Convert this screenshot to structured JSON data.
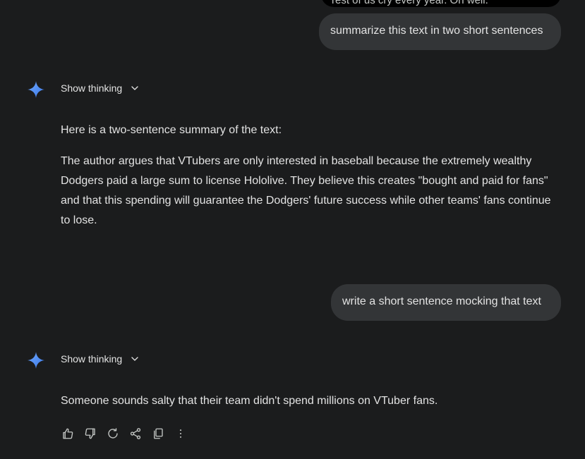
{
  "chat": {
    "prev_user_bubble_tail": "rest of us cry every year. Oh well.",
    "turn1": {
      "user_message": "summarize this text in two short sentences",
      "thinking_label": "Show thinking",
      "response_intro": "Here is a two-sentence summary of the text:",
      "response_body": "The author argues that VTubers are only interested in baseball because the extremely wealthy Dodgers paid a large sum to license Hololive. They believe this creates \"bought and paid for fans\" and that this spending will guarantee the Dodgers' future success while other teams' fans continue to lose."
    },
    "turn2": {
      "user_message": "write a short sentence mocking that text",
      "thinking_label": "Show thinking",
      "response_body": "Someone sounds salty that their team didn't spend millions on VTuber fans."
    }
  },
  "icons": {
    "assistant_avatar": "gemini-sparkle-icon",
    "thinking_toggle": "chevron-down-icon",
    "actions": [
      "thumbs-up-icon",
      "thumbs-down-icon",
      "regenerate-icon",
      "share-icon",
      "copy-icon",
      "more-vert-icon"
    ]
  },
  "colors": {
    "background": "#1b1c1d",
    "user_bubble": "#333537",
    "text": "#e3e3e3",
    "sparkle_blue": "#4c8df6"
  }
}
